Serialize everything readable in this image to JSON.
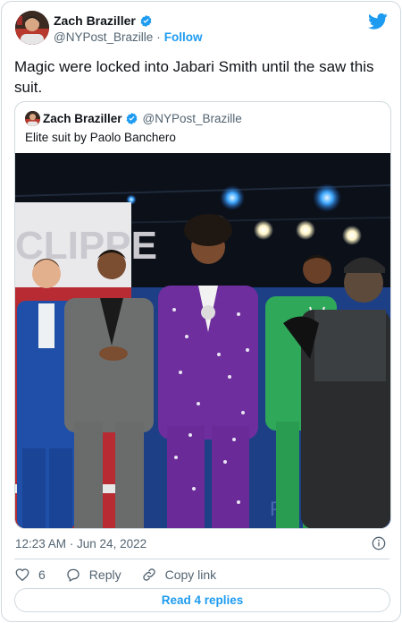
{
  "author": {
    "name": "Zach Braziller",
    "handle": "@NYPost_Brazille",
    "separator": "·",
    "follow_label": "Follow"
  },
  "tweet": {
    "text": "Magic were locked into Jabari Smith until the saw this suit.",
    "timestamp": "12:23 AM · Jun 24, 2022"
  },
  "quoted": {
    "name": "Zach Braziller",
    "handle": "@NYPost_Brazille",
    "text": "Elite suit by Paolo Banchero",
    "photo_sign_text": "CLIPPE",
    "photo_floor_text": "Pr"
  },
  "actions": {
    "like_count": "6",
    "reply_label": "Reply",
    "copy_label": "Copy link"
  },
  "read_replies_label": "Read 4 replies",
  "colors": {
    "accent": "#1d9bf0",
    "text": "#0f1419",
    "muted": "#536471",
    "border": "#cfd9de"
  },
  "icons": [
    "verified-badge-icon",
    "twitter-bird-icon",
    "info-icon",
    "heart-icon",
    "reply-bubble-icon",
    "link-icon"
  ]
}
